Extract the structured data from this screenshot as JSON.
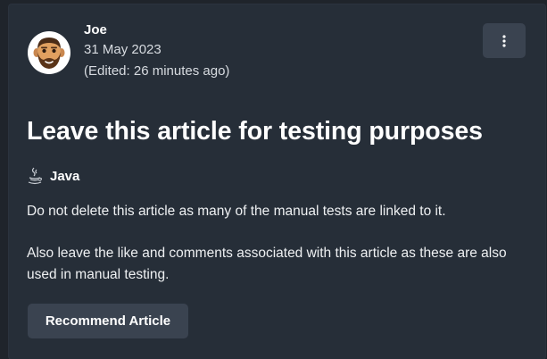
{
  "post": {
    "author": "Joe",
    "date": "31 May 2023",
    "edited": "(Edited: 26 minutes ago)",
    "avatar_icon": "bearded-man-emoji-avatar",
    "menu_icon": "vertical-ellipsis-icon",
    "title": "Leave this article for testing purposes",
    "tag": {
      "icon": "java-coffee-cup-icon",
      "label": "Java"
    },
    "body": [
      "Do not delete this article as many of the manual tests are linked to it.",
      "Also leave the like and comments associated with this article as these are also used in manual testing."
    ],
    "recommend_label": "Recommend Article"
  },
  "colors": {
    "page_bg": "#1f242b",
    "card_bg": "#262e38",
    "button_bg": "#3a4350",
    "text": "#ffffff"
  }
}
